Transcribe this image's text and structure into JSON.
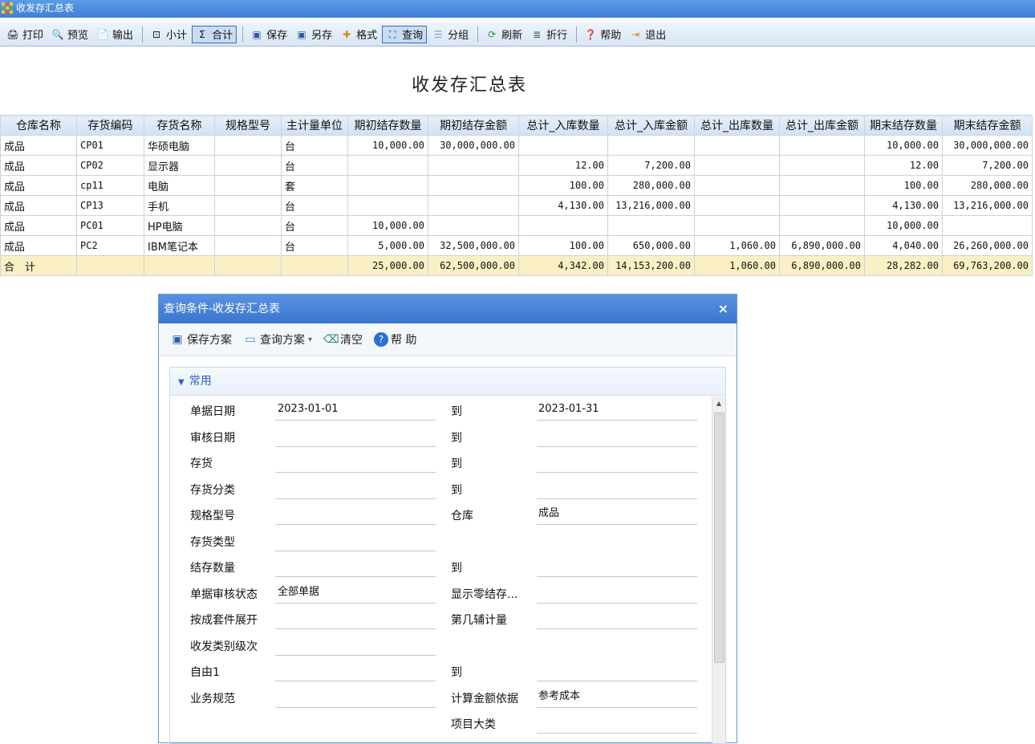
{
  "window": {
    "title": "收发存汇总表"
  },
  "toolbar": {
    "print": "打印",
    "preview": "预览",
    "export": "输出",
    "subtotal": "小计",
    "total": "合计",
    "save": "保存",
    "save_as": "另存",
    "format": "格式",
    "query": "查询",
    "group": "分组",
    "refresh": "刷新",
    "wrap": "折行",
    "help": "帮助",
    "exit": "退出",
    "subtotal_glyph": "⊡",
    "total_glyph": "Σ"
  },
  "report": {
    "title": "收发存汇总表",
    "columns": [
      "仓库名称",
      "存货编码",
      "存货名称",
      "规格型号",
      "主计量单位",
      "期初结存数量",
      "期初结存金额",
      "总计_入库数量",
      "总计_入库金额",
      "总计_出库数量",
      "总计_出库金额",
      "期末结存数量",
      "期末结存金额"
    ],
    "rows": [
      [
        "成品",
        "CP01",
        "华硕电脑",
        "",
        "台",
        "10,000.00",
        "30,000,000.00",
        "",
        "",
        "",
        "",
        "10,000.00",
        "30,000,000.00"
      ],
      [
        "成品",
        "CP02",
        "显示器",
        "",
        "台",
        "",
        "",
        "12.00",
        "7,200.00",
        "",
        "",
        "12.00",
        "7,200.00"
      ],
      [
        "成品",
        "cp11",
        "电脑",
        "",
        "套",
        "",
        "",
        "100.00",
        "280,000.00",
        "",
        "",
        "100.00",
        "280,000.00"
      ],
      [
        "成品",
        "CP13",
        "手机",
        "",
        "台",
        "",
        "",
        "4,130.00",
        "13,216,000.00",
        "",
        "",
        "4,130.00",
        "13,216,000.00"
      ],
      [
        "成品",
        "PC01",
        "HP电脑",
        "",
        "台",
        "10,000.00",
        "",
        "",
        "",
        "",
        "",
        "10,000.00",
        ""
      ],
      [
        "成品",
        "PC2",
        "IBM笔记本",
        "",
        "台",
        "5,000.00",
        "32,500,000.00",
        "100.00",
        "650,000.00",
        "1,060.00",
        "6,890,000.00",
        "4,040.00",
        "26,260,000.00"
      ]
    ],
    "total_row": [
      "合　计",
      "",
      "",
      "",
      "",
      "25,000.00",
      "62,500,000.00",
      "4,342.00",
      "14,153,200.00",
      "1,060.00",
      "6,890,000.00",
      "28,282.00",
      "69,763,200.00"
    ]
  },
  "dialog": {
    "title": "查询条件-收发存汇总表",
    "close": "×",
    "tools": {
      "save_plan": "保存方案",
      "query_plan": "查询方案",
      "clear": "清空",
      "help": "帮 助",
      "dropdown": "▾"
    },
    "section": "常用",
    "fields": [
      {
        "label": "单据日期",
        "value": "2023-01-01",
        "label2": "到",
        "value2": "2023-01-31"
      },
      {
        "label": "审核日期",
        "value": "",
        "label2": "到",
        "value2": ""
      },
      {
        "label": "存货",
        "value": "",
        "label2": "到",
        "value2": ""
      },
      {
        "label": "存货分类",
        "value": "",
        "label2": "到",
        "value2": ""
      },
      {
        "label": "规格型号",
        "value": "",
        "label2": "仓库",
        "value2": "成品"
      },
      {
        "label": "存货类型",
        "value": "",
        "label2": "",
        "value2": null
      },
      {
        "label": "结存数量",
        "value": "",
        "label2": "到",
        "value2": ""
      },
      {
        "label": "单据审核状态",
        "value": "全部单据",
        "label2": "显示零结存...",
        "value2": ""
      },
      {
        "label": "按成套件展开",
        "value": "",
        "label2": "第几辅计量",
        "value2": ""
      },
      {
        "label": "收发类别级次",
        "value": "",
        "label2": "",
        "value2": null
      },
      {
        "label": "自由1",
        "value": "",
        "label2": "到",
        "value2": ""
      },
      {
        "label": "业务规范",
        "value": "",
        "label2": "计算金额依据",
        "value2": "参考成本"
      },
      {
        "label": "",
        "value": null,
        "label2": "项目大类",
        "value2": ""
      }
    ]
  },
  "colors": {
    "titlebar": "#3f7fd6",
    "total_row": "#fbf0c4",
    "header": "#d2e1f2"
  }
}
